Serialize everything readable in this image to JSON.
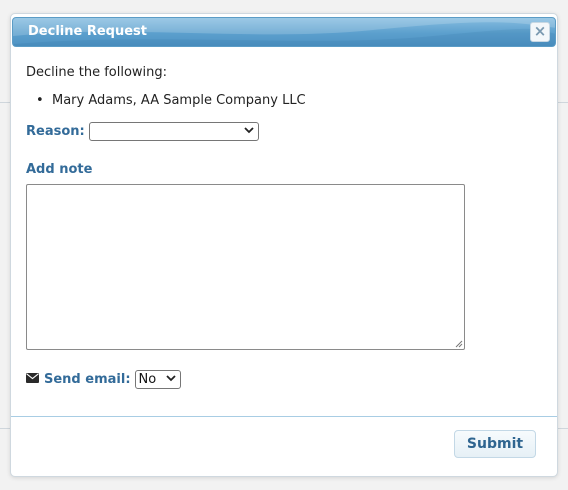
{
  "dialog": {
    "title": "Decline Request",
    "close_glyph": "×",
    "close_icon": "close-icon"
  },
  "body": {
    "intro": "Decline the following:",
    "items": [
      "Mary Adams, AA Sample Company LLC"
    ],
    "reason_label": "Reason:",
    "reason_value": "",
    "note_label": "Add note",
    "note_value": "",
    "send_email_icon": "envelope-icon",
    "send_email_label": "Send email:",
    "send_email_value": "No"
  },
  "footer": {
    "submit_label": "Submit"
  },
  "colors": {
    "titlebar": "#5b9fcd",
    "label": "#336b99",
    "submit_text": "#2f6590",
    "divider": "#a8cde4"
  }
}
